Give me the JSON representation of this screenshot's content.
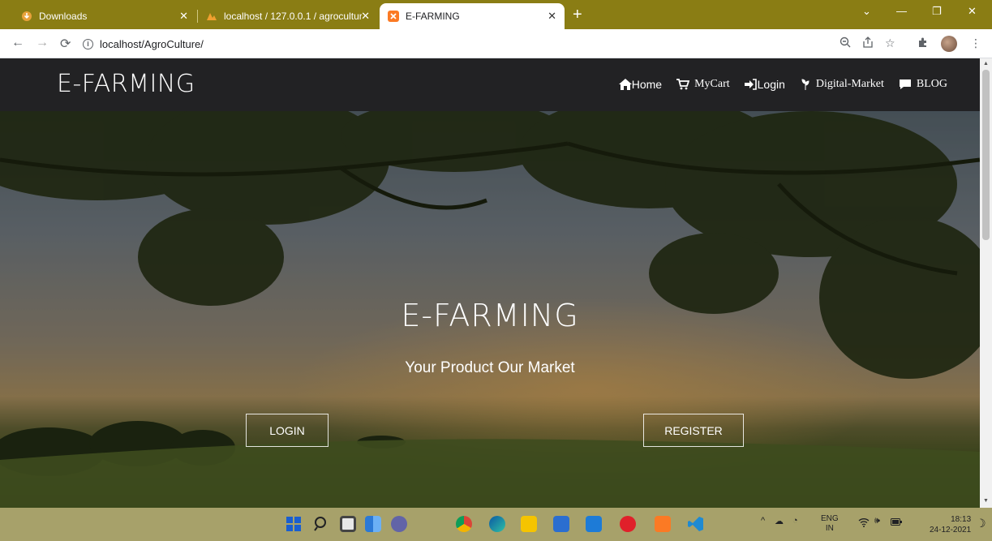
{
  "browser": {
    "tabs": [
      {
        "label": "Downloads",
        "active": false
      },
      {
        "label": "localhost / 127.0.0.1 / agroculture",
        "active": false
      },
      {
        "label": "E-FARMING",
        "active": true
      }
    ],
    "url": "localhost/AgroCulture/"
  },
  "site": {
    "brand": "E-FARMING",
    "menu": {
      "home": "Home",
      "cart": "MyCart",
      "login": "Login",
      "market": "Digital-Market",
      "blog": "BLOG"
    }
  },
  "hero": {
    "title": "E-FARMING",
    "subtitle": "Your Product Our Market",
    "login_button": "LOGIN",
    "register_button": "REGISTER"
  },
  "taskbar": {
    "language": "ENG",
    "region": "IN",
    "time": "18:13",
    "date": "24-12-2021"
  },
  "colors": {
    "tabstrip": "#8a7d14",
    "navbar": "#222224",
    "taskbar": "#a7a16a"
  }
}
